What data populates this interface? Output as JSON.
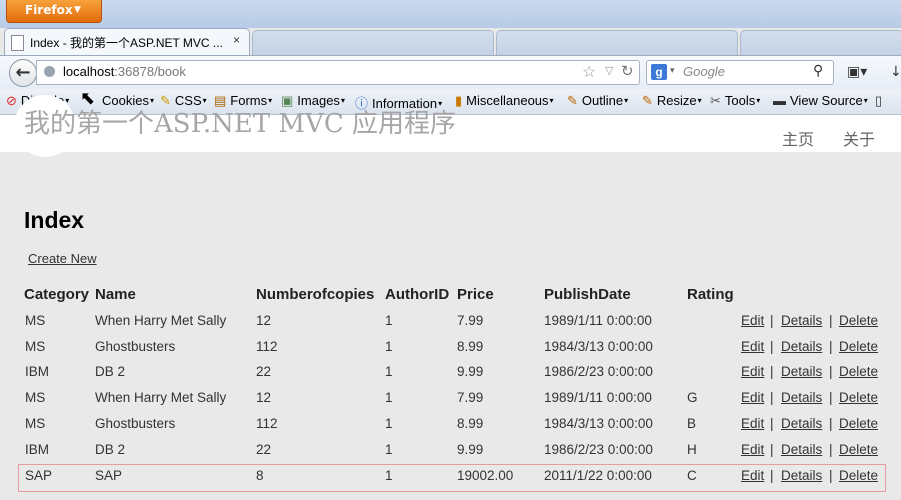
{
  "browser": {
    "menu_button": "Firefox",
    "tab": {
      "title": "Index - 我的第一个ASP.NET MVC ...",
      "close": "×"
    },
    "url": {
      "host": "localhost",
      "rest": ":36878/book"
    },
    "search_placeholder": "Google",
    "webdev_toolbar": [
      "Disable",
      "Cookies",
      "CSS",
      "Forms",
      "Images",
      "Information",
      "Miscellaneous",
      "Outline",
      "Resize",
      "Tools",
      "View Source"
    ]
  },
  "site": {
    "title": "我的第一个ASP.NET MVC 应用程序",
    "menu": [
      "主页",
      "关于"
    ]
  },
  "page": {
    "heading": "Index",
    "create_link": "Create New"
  },
  "table": {
    "columns": [
      "Category",
      "Name",
      "Numberofcopies",
      "AuthorID",
      "Price",
      "PublishDate",
      "Rating"
    ],
    "rows": [
      [
        "MS",
        "When Harry Met Sally",
        "12",
        "1",
        "7.99",
        "1989/1/11 0:00:00",
        ""
      ],
      [
        "MS",
        "Ghostbusters",
        "112",
        "1",
        "8.99",
        "1984/3/13 0:00:00",
        ""
      ],
      [
        "IBM",
        "DB 2",
        "22",
        "1",
        "9.99",
        "1986/2/23 0:00:00",
        ""
      ],
      [
        "MS",
        "When Harry Met Sally",
        "12",
        "1",
        "7.99",
        "1989/1/11 0:00:00",
        "G"
      ],
      [
        "MS",
        "Ghostbusters",
        "112",
        "1",
        "8.99",
        "1984/3/13 0:00:00",
        "B"
      ],
      [
        "IBM",
        "DB 2",
        "22",
        "1",
        "9.99",
        "1986/2/23 0:00:00",
        "H"
      ],
      [
        "SAP",
        "SAP",
        "8",
        "1",
        "19002.00",
        "2011/1/22 0:00:00",
        "C"
      ]
    ],
    "actions": [
      "Edit",
      "Details",
      "Delete"
    ],
    "separator": "|",
    "highlight_color": "#e89aa0"
  }
}
